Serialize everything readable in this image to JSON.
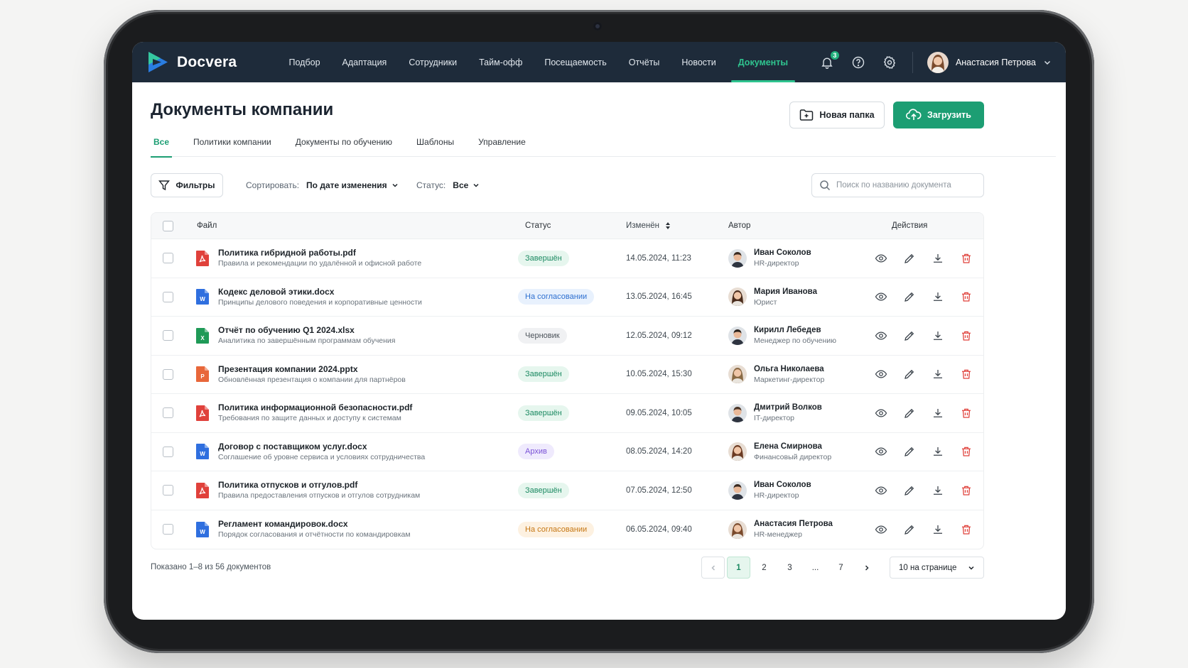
{
  "app": {
    "name": "Docvera"
  },
  "nav": {
    "items": [
      "Подбор",
      "Адаптация",
      "Сотрудники",
      "Тайм-офф",
      "Посещаемость",
      "Отчёты",
      "Новости",
      "Документы"
    ],
    "active": "Документы",
    "notifications_count": "3",
    "user_name": "Анастасия Петрова"
  },
  "page": {
    "title": "Документы компании",
    "new_folder_label": "Новая папка",
    "upload_label": "Загрузить",
    "tabs": [
      "Все",
      "Политики компании",
      "Документы по обучению",
      "Шаблоны",
      "Управление"
    ],
    "active_tab": "Все"
  },
  "filters": {
    "filter_label": "Фильтры",
    "sort_label": "Сортировать:",
    "sort_value": "По дате изменения",
    "status_label": "Статус:",
    "status_value": "Все",
    "search_placeholder": "Поиск по названию документа"
  },
  "table": {
    "columns": {
      "file": "Файл",
      "status": "Статус",
      "modified": "Изменён",
      "author": "Автор",
      "actions": "Действия"
    },
    "rows": [
      {
        "type": "pdf",
        "name": "Политика гибридной работы.pdf",
        "desc": "Правила и рекомендации по удалённой и офисной работе",
        "status": "Завершён",
        "status_kind": "done",
        "date": "14.05.2024, 11:23",
        "author": "Иван Соколов",
        "role": "HR-директор",
        "avatar": "m1"
      },
      {
        "type": "docx",
        "name": "Кодекс деловой этики.docx",
        "desc": "Принципы делового поведения и корпоративные ценности",
        "status": "На согласовании",
        "status_kind": "review",
        "date": "13.05.2024, 16:45",
        "author": "Мария Иванова",
        "role": "Юрист",
        "avatar": "f1"
      },
      {
        "type": "xlsx",
        "name": "Отчёт по обучению Q1 2024.xlsx",
        "desc": "Аналитика по завершённым программам обучения",
        "status": "Черновик",
        "status_kind": "draft",
        "date": "12.05.2024, 09:12",
        "author": "Кирилл Лебедев",
        "role": "Менеджер по обучению",
        "avatar": "m2"
      },
      {
        "type": "pptx",
        "name": "Презентация компании 2024.pptx",
        "desc": "Обновлённая презентация о компании для партнёров",
        "status": "Завершён",
        "status_kind": "done",
        "date": "10.05.2024, 15:30",
        "author": "Ольга Николаева",
        "role": "Маркетинг-директор",
        "avatar": "f2"
      },
      {
        "type": "pdf",
        "name": "Политика информационной безопасности.pdf",
        "desc": "Требования по защите данных и доступу к системам",
        "status": "Завершён",
        "status_kind": "done",
        "date": "09.05.2024, 10:05",
        "author": "Дмитрий Волков",
        "role": "IT-директор",
        "avatar": "m3"
      },
      {
        "type": "docx",
        "name": "Договор с поставщиком услуг.docx",
        "desc": "Соглашение об уровне сервиса и условиях сотрудничества",
        "status": "Архив",
        "status_kind": "archive",
        "date": "08.05.2024, 14:20",
        "author": "Елена Смирнова",
        "role": "Финансовый директор",
        "avatar": "f3"
      },
      {
        "type": "pdf",
        "name": "Политика отпусков и отгулов.pdf",
        "desc": "Правила предоставления отпусков и отгулов сотрудникам",
        "status": "Завершён",
        "status_kind": "done",
        "date": "07.05.2024, 12:50",
        "author": "Иван Соколов",
        "role": "HR-директор",
        "avatar": "m1"
      },
      {
        "type": "docx",
        "name": "Регламент командировок.docx",
        "desc": "Порядок согласования и отчётности по командировкам",
        "status": "На согласовании",
        "status_kind": "pending",
        "date": "06.05.2024, 09:40",
        "author": "Анастасия Петрова",
        "role": "HR-менеджер",
        "avatar": "f4"
      }
    ]
  },
  "footer": {
    "shown_text": "Показано 1–8 из 56 документов",
    "pages": [
      "1",
      "2",
      "3",
      "...",
      "7"
    ],
    "current_page": "1",
    "per_page": "10 на странице"
  },
  "colors": {
    "nav_bg": "#1e2b3a",
    "accent": "#1c9e73",
    "accent_nav": "#2fc48f",
    "danger": "#e0413b"
  }
}
